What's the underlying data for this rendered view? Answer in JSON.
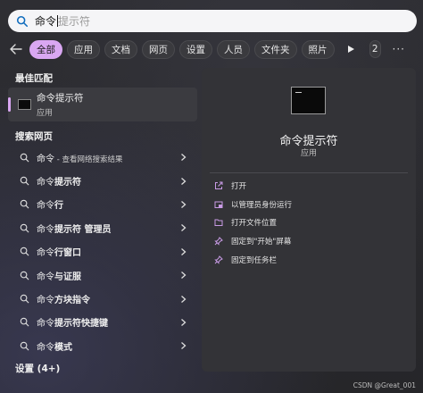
{
  "search": {
    "typed": "命令",
    "suggestion": "提示符"
  },
  "filters": {
    "chips": [
      "全部",
      "应用",
      "文档",
      "网页",
      "设置",
      "人员",
      "文件夹",
      "照片"
    ],
    "count": "2",
    "more": "···"
  },
  "left": {
    "best_match_title": "最佳匹配",
    "best_match": {
      "name": "命令提示符",
      "type": "应用"
    },
    "web_title": "搜索网页",
    "web_items": [
      {
        "prefix": "命令",
        "bold": "",
        "suffix": " - 查看网络搜索结果"
      },
      {
        "prefix": "命令",
        "bold": "提示符",
        "suffix": ""
      },
      {
        "prefix": "命令",
        "bold": "行",
        "suffix": ""
      },
      {
        "prefix": "命令",
        "bold": "提示符 管理员",
        "suffix": ""
      },
      {
        "prefix": "命令",
        "bold": "行窗口",
        "suffix": ""
      },
      {
        "prefix": "命令",
        "bold": "与证服",
        "suffix": ""
      },
      {
        "prefix": "命令",
        "bold": "方块指令",
        "suffix": ""
      },
      {
        "prefix": "命令",
        "bold": "提示符快捷键",
        "suffix": ""
      },
      {
        "prefix": "命令",
        "bold": "模式",
        "suffix": ""
      }
    ],
    "settings_title": "设置 (4+)"
  },
  "right": {
    "app_name": "命令提示符",
    "app_type": "应用",
    "actions": [
      {
        "icon": "open-external-icon",
        "label": "打开"
      },
      {
        "icon": "admin-shield-icon",
        "label": "以管理员身份运行"
      },
      {
        "icon": "folder-icon",
        "label": "打开文件位置"
      },
      {
        "icon": "pin-icon",
        "label": "固定到\"开始\"屏幕"
      },
      {
        "icon": "pin-icon",
        "label": "固定到任务栏"
      }
    ]
  },
  "watermark": "CSDN @Great_001",
  "colors": {
    "accent": "#d9a7f2",
    "panel": "#333337",
    "background": "#2a2a2e"
  }
}
